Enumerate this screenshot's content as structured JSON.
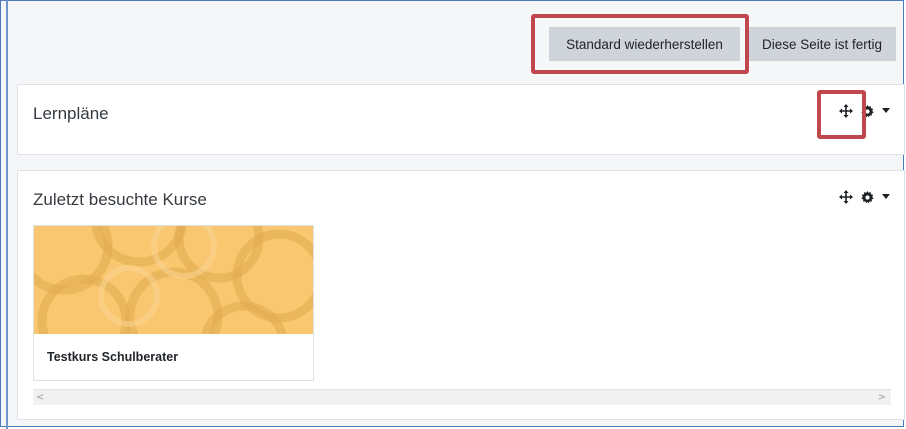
{
  "toolbar": {
    "reset_label": "Standard wiederherstellen",
    "done_label": "Diese Seite ist fertig"
  },
  "blocks": [
    {
      "title": "Lernpläne",
      "icons": [
        "move-icon",
        "gear-icon",
        "caret-down-icon"
      ]
    },
    {
      "title": "Zuletzt besuchte Kurse",
      "icons": [
        "move-icon",
        "gear-icon",
        "caret-down-icon"
      ]
    }
  ],
  "recent_courses": [
    {
      "name": "Testkurs Schulberater"
    }
  ],
  "scrollbar": {
    "left_arrow": "<",
    "right_arrow": ">"
  },
  "colors": {
    "highlight": "#c0474d",
    "course_image": "#f9c770",
    "button": "#ced4da"
  }
}
